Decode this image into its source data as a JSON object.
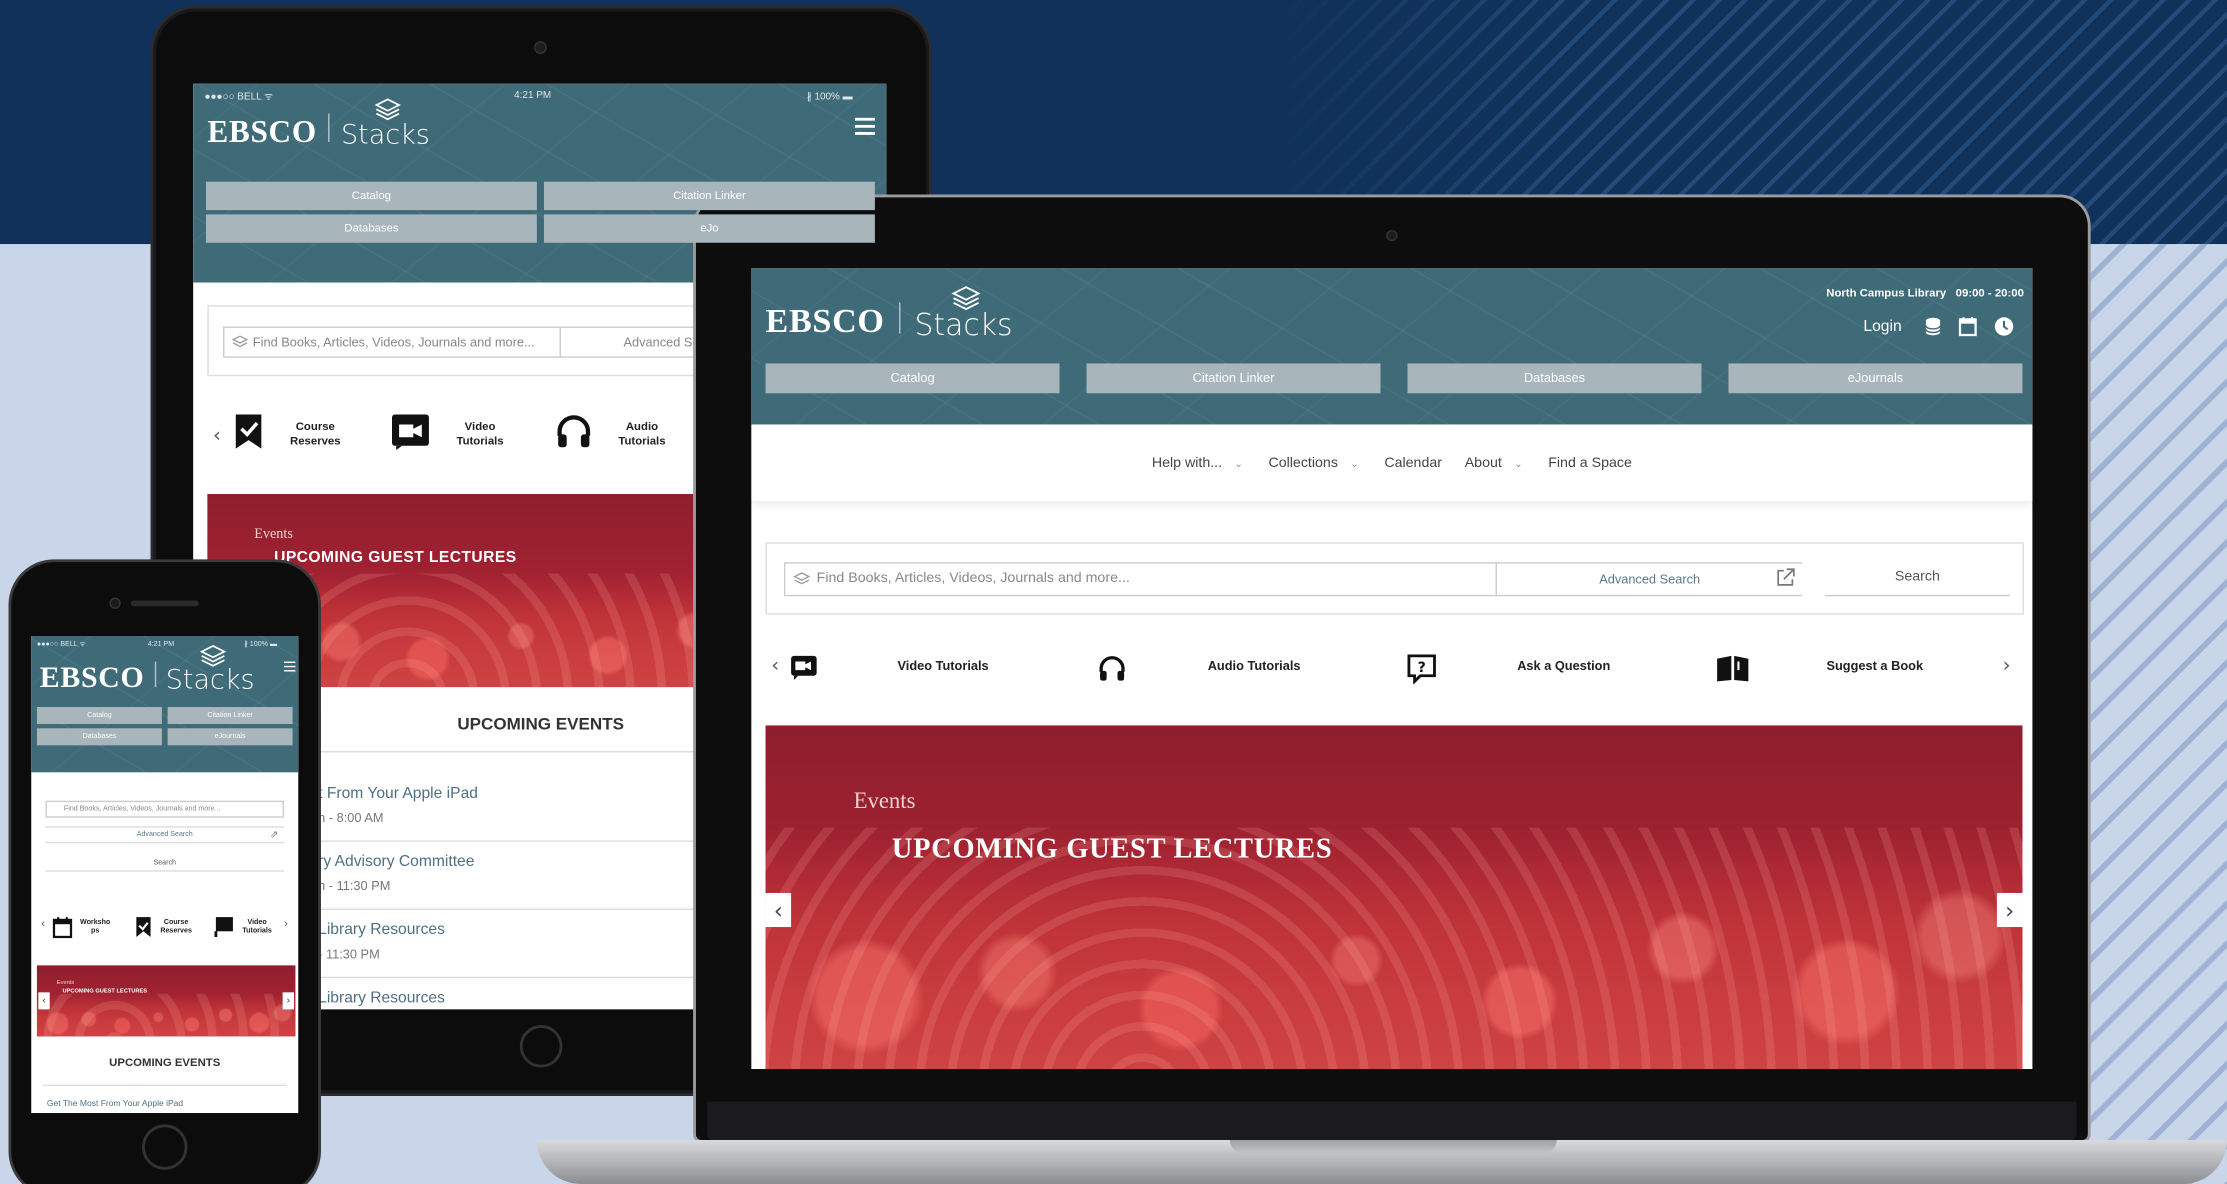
{
  "ipad": {
    "status": {
      "carrier": "●●●○○ BELL ᯤ",
      "time": "4:21 PM",
      "battery": "∦ 100% ▬"
    },
    "logo": {
      "ebsco": "EBSCO",
      "stacks": "Stacks"
    },
    "nav": [
      "Catalog",
      "Citation Linker",
      "Databases",
      "eJo"
    ],
    "search": {
      "placeholder": "Find Books, Articles, Videos, Journals and more...",
      "advanced": "Advanced Se"
    },
    "quicklinks": [
      {
        "line1": "Course",
        "line2": "Reserves",
        "icon": "checkmark-bookmark-icon"
      },
      {
        "line1": "Video",
        "line2": "Tutorials",
        "icon": "video-camera-icon"
      },
      {
        "line1": "Audio",
        "line2": "Tutorials",
        "icon": "headphones-icon"
      }
    ],
    "hero": {
      "kicker": "Events",
      "title": "UPCOMING GUEST LECTURES"
    },
    "events_heading": "UPCOMING EVENTS",
    "events": [
      {
        "title": "t From Your Apple iPad",
        "time": "h - 8:00 AM"
      },
      {
        "title": "ry Advisory Committee",
        "time": "h - 11:30 PM"
      },
      {
        "title": "Library Resources",
        "time": "- 11:30 PM"
      },
      {
        "title": "Library Resources",
        "time": ""
      }
    ]
  },
  "iphone": {
    "status": {
      "carrier": "●●●○○ BELL ᯤ",
      "time": "4:21 PM",
      "battery": "∦ 100% ▬"
    },
    "logo": {
      "ebsco": "EBSCO",
      "stacks": "Stacks"
    },
    "nav": [
      "Catalog",
      "Citation Linker",
      "Databases",
      "eJournals"
    ],
    "search": {
      "placeholder": "Find Books, Articles, Videos, Journals and more...",
      "advanced": "Advanced Search",
      "button": "Search"
    },
    "quicklinks": [
      {
        "line1": "Worksho",
        "line2": "ps",
        "icon": "calendar-icon"
      },
      {
        "line1": "Course",
        "line2": "Reserves",
        "icon": "checkmark-bookmark-icon"
      },
      {
        "line1": "Video",
        "line2": "Tutorials",
        "icon": "video-flag-icon"
      }
    ],
    "hero": {
      "kicker": "Events",
      "title": "UPCOMING GUEST LECTURES"
    },
    "events_heading": "UPCOMING EVENTS",
    "first_event": "Get The Most From Your Apple iPad"
  },
  "laptop": {
    "topbar": {
      "library": "North Campus Library",
      "hours": "09:00 - 20:00",
      "login": "Login"
    },
    "logo": {
      "ebsco": "EBSCO",
      "stacks": "Stacks"
    },
    "nav": [
      "Catalog",
      "Citation Linker",
      "Databases",
      "eJournals"
    ],
    "menu": [
      {
        "label": "Help with...",
        "dropdown": true
      },
      {
        "label": "Collections",
        "dropdown": true
      },
      {
        "label": "Calendar",
        "dropdown": false
      },
      {
        "label": "About",
        "dropdown": true
      },
      {
        "label": "Find a Space",
        "dropdown": false
      }
    ],
    "search": {
      "placeholder": "Find Books, Articles, Videos, Journals and more...",
      "advanced": "Advanced Search",
      "button": "Search"
    },
    "quicklinks": [
      {
        "label": "Video Tutorials",
        "icon": "video-camera-icon"
      },
      {
        "label": "Audio Tutorials",
        "icon": "headphones-icon"
      },
      {
        "label": "Ask a Question",
        "icon": "question-bubble-icon"
      },
      {
        "label": "Suggest a Book",
        "icon": "open-book-icon"
      }
    ],
    "hero": {
      "kicker": "Events",
      "title": "UPCOMING GUEST LECTURES"
    }
  },
  "colors": {
    "header": "#3f6a78",
    "navbtn": "#a8b5ba",
    "hero": "#a32232",
    "bg_dark": "#10325a",
    "bg_light": "#c9d6ea"
  }
}
